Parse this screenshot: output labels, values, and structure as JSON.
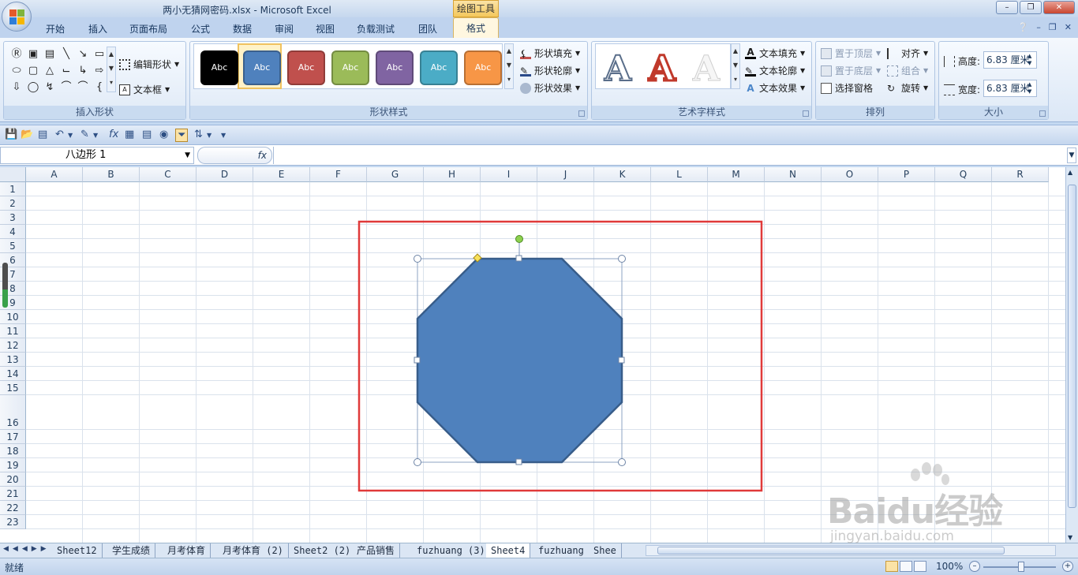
{
  "window": {
    "title": "两小无猜网密码.xlsx - Microsoft Excel",
    "context_tool": "绘图工具"
  },
  "tabs": [
    "开始",
    "插入",
    "页面布局",
    "公式",
    "数据",
    "审阅",
    "视图",
    "负载测试",
    "团队",
    "格式"
  ],
  "active_tab": "格式",
  "ribbon": {
    "insert_shapes": {
      "label": "插入形状",
      "edit_shape": "编辑形状",
      "textbox": "文本框"
    },
    "shape_styles": {
      "label": "形状样式",
      "preset_text": "Abc",
      "fill": "形状填充",
      "outline": "形状轮廓",
      "effects": "形状效果",
      "presets": [
        {
          "color": "#000000"
        },
        {
          "color": "#4f81bd"
        },
        {
          "color": "#c0504d"
        },
        {
          "color": "#9bbb59"
        },
        {
          "color": "#8064a2"
        },
        {
          "color": "#4bacc6"
        },
        {
          "color": "#f79646"
        }
      ]
    },
    "wordart": {
      "label": "艺术字样式",
      "glyph": "A",
      "text_fill": "文本填充",
      "text_outline": "文本轮廓",
      "text_effects": "文本效果"
    },
    "arrange": {
      "label": "排列",
      "bring_front": "置于顶层",
      "send_back": "置于底层",
      "selection_pane": "选择窗格",
      "align": "对齐",
      "group": "组合",
      "rotate": "旋转"
    },
    "size": {
      "label": "大小",
      "height_label": "高度:",
      "height_value": "6.83 厘米",
      "width_label": "宽度:",
      "width_value": "6.83 厘米"
    }
  },
  "formula_bar": {
    "name_box": "八边形 1",
    "fx": "fx"
  },
  "columns": [
    "A",
    "B",
    "C",
    "D",
    "E",
    "F",
    "G",
    "H",
    "I",
    "J",
    "K",
    "L",
    "M",
    "N",
    "O",
    "P",
    "Q",
    "R"
  ],
  "rows": [
    "1",
    "2",
    "3",
    "4",
    "5",
    "6",
    "7",
    "8",
    "9",
    "10",
    "11",
    "12",
    "13",
    "14",
    "15",
    "16",
    "17",
    "18",
    "19",
    "20",
    "21",
    "22",
    "23"
  ],
  "sheets": [
    "Sheet12",
    "学生成绩",
    "月考体育",
    "月考体育 (2)",
    "Sheet2 (2)",
    "产品销售",
    "fuzhuang (3)",
    "Sheet4",
    "fuzhuang",
    "Shee"
  ],
  "active_sheet": "Sheet4",
  "status": {
    "ready": "就绪",
    "zoom": "100%"
  },
  "shape": {
    "type": "octagon",
    "fill": "#4f81bd",
    "outline": "#385d8a"
  },
  "highlight_color": "#e03a3a",
  "watermark": {
    "main": "Baidu经验",
    "sub": "jingyan.baidu.com"
  }
}
